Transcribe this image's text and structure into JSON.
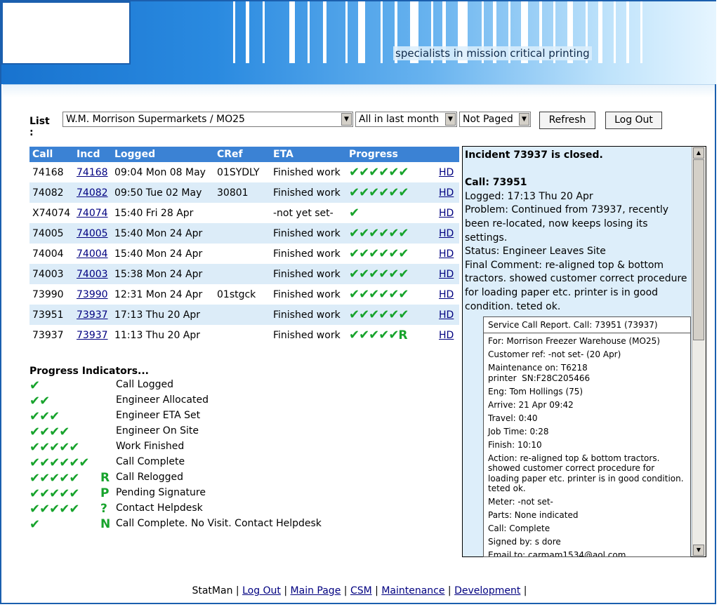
{
  "header": {
    "tagline": "specialists in mission critical printing"
  },
  "controls": {
    "list_label": "List :",
    "customer_select": "W.M. Morrison Supermarkets / MO25",
    "period_select": "All in last month",
    "paged_select": "Not Paged",
    "refresh_label": "Refresh",
    "logout_label": "Log Out"
  },
  "table": {
    "headers": [
      "Call",
      "Incd",
      "Logged",
      "CRef",
      "ETA",
      "Progress"
    ],
    "rows": [
      {
        "call": "74168",
        "incd": "74168",
        "logged": "09:04 Mon 08 May",
        "cref": "01SYDLY",
        "eta": "Finished work",
        "ticks": "✔✔✔✔✔✔",
        "letter": "",
        "hd": "HD"
      },
      {
        "call": "74082",
        "incd": "74082",
        "logged": "09:50 Tue 02 May",
        "cref": "30801",
        "eta": "Finished work",
        "ticks": "✔✔✔✔✔✔",
        "letter": "",
        "hd": "HD"
      },
      {
        "call": "X74074",
        "incd": "74074",
        "logged": "15:40 Fri 28 Apr",
        "cref": "",
        "eta": "-not yet set-",
        "ticks": "✔",
        "letter": "",
        "hd": "HD"
      },
      {
        "call": "74005",
        "incd": "74005",
        "logged": "15:40 Mon 24 Apr",
        "cref": "",
        "eta": "Finished work",
        "ticks": "✔✔✔✔✔✔",
        "letter": "",
        "hd": "HD"
      },
      {
        "call": "74004",
        "incd": "74004",
        "logged": "15:40 Mon 24 Apr",
        "cref": "",
        "eta": "Finished work",
        "ticks": "✔✔✔✔✔✔",
        "letter": "",
        "hd": "HD"
      },
      {
        "call": "74003",
        "incd": "74003",
        "logged": "15:38 Mon 24 Apr",
        "cref": "",
        "eta": "Finished work",
        "ticks": "✔✔✔✔✔✔",
        "letter": "",
        "hd": "HD"
      },
      {
        "call": "73990",
        "incd": "73990",
        "logged": "12:31 Mon 24 Apr",
        "cref": "01stgck",
        "eta": "Finished work",
        "ticks": "✔✔✔✔✔✔",
        "letter": "",
        "hd": "HD"
      },
      {
        "call": "73951",
        "incd": "73937",
        "logged": "17:13 Thu 20 Apr",
        "cref": "",
        "eta": "Finished work",
        "ticks": "✔✔✔✔✔✔",
        "letter": "",
        "hd": "HD"
      },
      {
        "call": "73937",
        "incd": "73937",
        "logged": "11:13 Thu 20 Apr",
        "cref": "",
        "eta": "Finished work",
        "ticks": "✔✔✔✔✔",
        "letter": "R",
        "hd": "HD"
      }
    ]
  },
  "legend": {
    "title": "Progress Indicators...",
    "items": [
      {
        "ticks": "✔",
        "letter": "",
        "text": "Call Logged"
      },
      {
        "ticks": "✔✔",
        "letter": "",
        "text": "Engineer Allocated"
      },
      {
        "ticks": "✔✔✔",
        "letter": "",
        "text": "Engineer ETA Set"
      },
      {
        "ticks": "✔✔✔✔",
        "letter": "",
        "text": "Engineer On Site"
      },
      {
        "ticks": "✔✔✔✔✔",
        "letter": "",
        "text": "Work Finished"
      },
      {
        "ticks": "✔✔✔✔✔✔",
        "letter": "",
        "text": "Call Complete"
      },
      {
        "ticks": "✔✔✔✔✔",
        "letter": "R",
        "text": "Call Relogged"
      },
      {
        "ticks": "✔✔✔✔✔",
        "letter": "P",
        "text": "Pending Signature"
      },
      {
        "ticks": "✔✔✔✔✔",
        "letter": "?",
        "text": "Contact Helpdesk"
      },
      {
        "ticks": "✔",
        "letter": "N",
        "text": "Call Complete. No Visit. Contact Helpdesk"
      }
    ]
  },
  "incident": {
    "closed_msg": "Incident 73937 is closed.",
    "call_title": "Call: 73951",
    "logged": "Logged: 17:13 Thu 20 Apr",
    "problem": "Problem: Continued from 73937, recently been re-located, now keeps losing its settings.",
    "status": "Status: Engineer Leaves Site",
    "final_comment": "Final Comment: re-aligned top & bottom tractors. showed customer correct procedure for loading paper etc. printer is in good condition. teted ok."
  },
  "report": {
    "title": "Service Call Report. Call: 73951 (73937)",
    "lines": [
      "For: Morrison Freezer Warehouse (MO25)",
      "Customer ref: -not set- (20 Apr)",
      "Maintenance on: T6218 printer  SN:F28C205466",
      "Eng: Tom Hollings (75)",
      "Arrive: 21 Apr 09:42",
      "Travel: 0:40",
      "Job Time: 0:28",
      "Finish: 10:10",
      "Action: re-aligned top & bottom tractors. showed customer correct procedure for loading paper etc. printer is in good condition. teted ok.",
      "Meter: -not set-",
      "Parts: None indicated",
      "Call: Complete",
      "Signed by: s dore",
      "Email to: carmam1534@aol.com"
    ]
  },
  "footer": {
    "statman": "StatMan",
    "links": [
      "Log Out",
      "Main Page",
      "CSM",
      "Maintenance",
      "Development"
    ]
  }
}
